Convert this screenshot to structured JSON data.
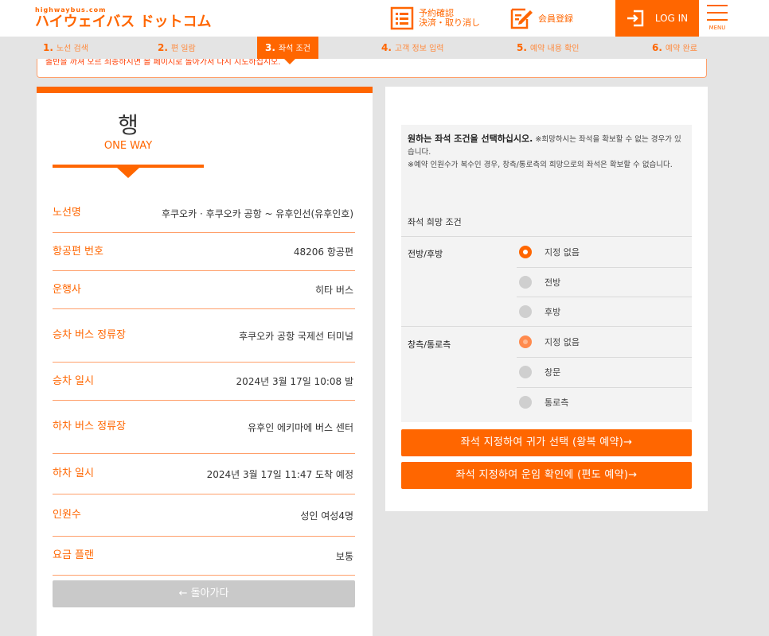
{
  "header": {
    "logo_small": "highwaybus.com",
    "logo_main": "ハイウェイバス ドットコム",
    "reserve_line1": "予約確認",
    "reserve_line2": "決済・取り消し",
    "register_label": "会員登録",
    "login_label": "LOG IN",
    "menu_label": "MENU",
    "accent_color": "#ff6600"
  },
  "steps": [
    {
      "num": "1.",
      "label": "노선 검색"
    },
    {
      "num": "2.",
      "label": "편 일람"
    },
    {
      "num": "3.",
      "label": "좌석 조건"
    },
    {
      "num": "4.",
      "label": "고객 정보 입력"
    },
    {
      "num": "5.",
      "label": "예약 내용 확인"
    },
    {
      "num": "6.",
      "label": "예약 완료"
    }
  ],
  "notice": "출반을 까져 오르 죄송하시면 볼 페이지로 돌아가서 다시 지도하십시오.",
  "trip": {
    "title_kr": "행",
    "title_en": "ONE WAY",
    "rows": [
      {
        "key": "노선명",
        "value": "후쿠오카 · 후쿠오카 공항 ~ 유후인선(유후인호)"
      },
      {
        "key": "항공편 번호",
        "value": "48206 항공편"
      },
      {
        "key": "운행사",
        "value": "히타 버스"
      },
      {
        "key": "승차 버스 정류장",
        "value": "후쿠오카 공항 국제선 터미널"
      },
      {
        "key": "승차 일시",
        "value": "2024년 3월 17일 10:08 발"
      },
      {
        "key": "하차 버스 정류장",
        "value": "유후인 에키마에 버스 센터"
      },
      {
        "key": "하차 일시",
        "value": "2024년 3월 17일 11:47 도착 예정"
      },
      {
        "key": "인원수",
        "value": "성인 여성4명"
      },
      {
        "key": "요금 플랜",
        "value": "보통"
      }
    ],
    "back_label": "← 돌아가다"
  },
  "seat": {
    "desc_bold": "원하는 좌석 조건을 선택하십시오.",
    "desc_text": " ※희망하시는 좌석을 확보할 수 없는 경우가 있습니다.",
    "desc_note": "※예약 인원수가 복수인 경우, 창측/통로측의 희망으로의 좌석은 확보할 수 없습니다.",
    "section_title": "좌석 희망 조건",
    "front_back_label": "전방/후방",
    "front_back_options": [
      "지정 없음",
      "전방",
      "후방"
    ],
    "window_aisle_label": "창측/통로측",
    "window_aisle_options": [
      "지정 없음",
      "창문",
      "통로측"
    ],
    "btn_round": "좌석 지정하여 귀가 선택 (왕복 예약)→",
    "btn_oneway": "좌석 지정하여 운임 확인에 (편도 예약)→"
  }
}
